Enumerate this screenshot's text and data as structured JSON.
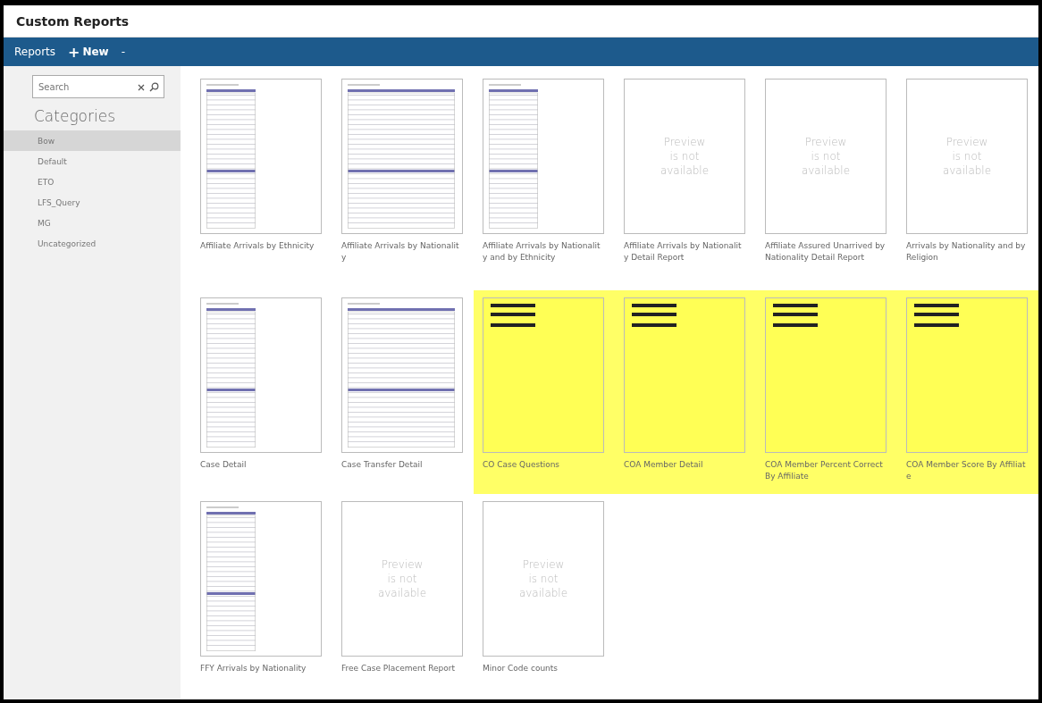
{
  "window": {
    "title": "Custom Reports"
  },
  "toolbar": {
    "menu": "Reports",
    "new_button": "New",
    "new_icon": "+",
    "dropdown": "-"
  },
  "sidebar": {
    "search": {
      "placeholder": "Search"
    },
    "heading": "Categories",
    "items": [
      {
        "label": "Bow",
        "selected": true
      },
      {
        "label": "Default",
        "selected": false
      },
      {
        "label": "ETO",
        "selected": false
      },
      {
        "label": "LFS_Query",
        "selected": false
      },
      {
        "label": "MG",
        "selected": false
      },
      {
        "label": "Uncategorized",
        "selected": false
      }
    ]
  },
  "reports": [
    {
      "label": "Affiliate Arrivals by Ethnicity",
      "kind": "table",
      "highlighted": false
    },
    {
      "label": "Affiliate Arrivals by Nationality",
      "kind": "table",
      "highlighted": false
    },
    {
      "label": "Affiliate Arrivals by Nationality and by Ethnicity",
      "kind": "table",
      "highlighted": false
    },
    {
      "label": "Affiliate Arrivals by Nationality Detail Report",
      "kind": "none",
      "highlighted": false,
      "message": [
        "Preview",
        "is not",
        "available"
      ]
    },
    {
      "label": "Affiliate Assured Unarrived by Nationality Detail Report",
      "kind": "none",
      "highlighted": false,
      "message": [
        "Preview",
        "is not",
        "available"
      ]
    },
    {
      "label": "Arrivals by Nationality and by Religion",
      "kind": "none",
      "highlighted": false,
      "message": [
        "Preview",
        "is not",
        "available"
      ]
    },
    {
      "label": "Case Detail",
      "kind": "table",
      "highlighted": false
    },
    {
      "label": "Case Transfer Detail",
      "kind": "table",
      "highlighted": false
    },
    {
      "label": "CO Case Questions",
      "kind": "sparse",
      "highlighted": true
    },
    {
      "label": "COA Member Detail",
      "kind": "sparse",
      "highlighted": true
    },
    {
      "label": "COA Member Percent Correct By Affiliate",
      "kind": "sparse",
      "highlighted": true
    },
    {
      "label": "COA Member Score By Affiliate",
      "kind": "sparse",
      "highlighted": true
    },
    {
      "label": "FFY Arrivals by Nationality",
      "kind": "table",
      "highlighted": false
    },
    {
      "label": "Free Case Placement Report",
      "kind": "none",
      "highlighted": false,
      "message": [
        "Preview",
        "is not",
        "available"
      ]
    },
    {
      "label": "Minor Code counts",
      "kind": "none",
      "highlighted": false,
      "message": [
        "Preview",
        "is not",
        "available"
      ]
    }
  ]
}
